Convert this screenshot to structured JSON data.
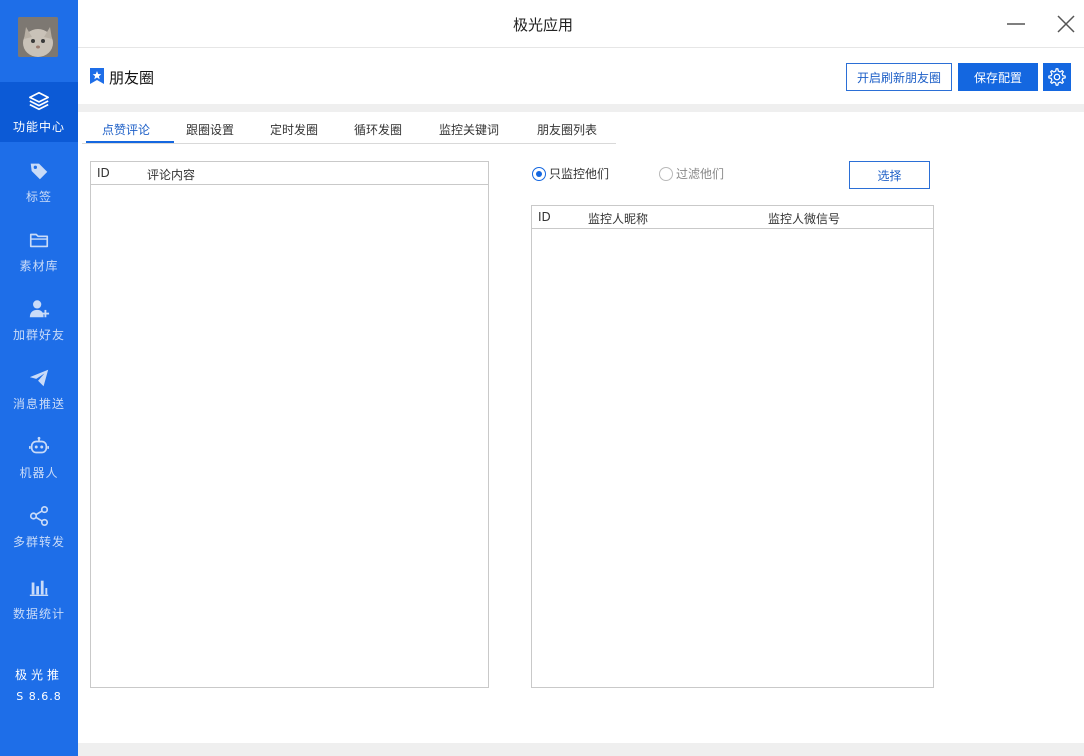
{
  "window": {
    "title": "极光应用"
  },
  "colors": {
    "sidebar": "#1e6ee8",
    "sidebar_active": "#0c5ad6",
    "accent": "#1467e0"
  },
  "sidebar": {
    "items": [
      {
        "label": "功能中心",
        "icon": "layers-icon",
        "active": true
      },
      {
        "label": "标签",
        "icon": "tag-icon"
      },
      {
        "label": "素材库",
        "icon": "folder-icon"
      },
      {
        "label": "加群好友",
        "icon": "add-user-icon"
      },
      {
        "label": "消息推送",
        "icon": "send-icon"
      },
      {
        "label": "机器人",
        "icon": "robot-icon"
      },
      {
        "label": "多群转发",
        "icon": "share-icon"
      },
      {
        "label": "数据统计",
        "icon": "bar-chart-icon"
      }
    ],
    "brand": "极光推",
    "version": "S 8.6.8"
  },
  "header": {
    "title": "朋友圈",
    "refresh_label": "开启刷新朋友圈",
    "save_label": "保存配置"
  },
  "tabs": [
    {
      "label": "点赞评论",
      "active": true
    },
    {
      "label": "跟圈设置"
    },
    {
      "label": "定时发圈"
    },
    {
      "label": "循环发圈"
    },
    {
      "label": "监控关键词"
    },
    {
      "label": "朋友圈列表"
    }
  ],
  "comment_table": {
    "columns": [
      "ID",
      "评论内容"
    ],
    "rows": []
  },
  "monitor": {
    "radio_only": "只监控他们",
    "radio_filter": "过滤他们",
    "selected": "只监控他们",
    "select_label": "选择"
  },
  "monitor_table": {
    "columns": [
      "ID",
      "监控人昵称",
      "监控人微信号"
    ],
    "rows": []
  }
}
